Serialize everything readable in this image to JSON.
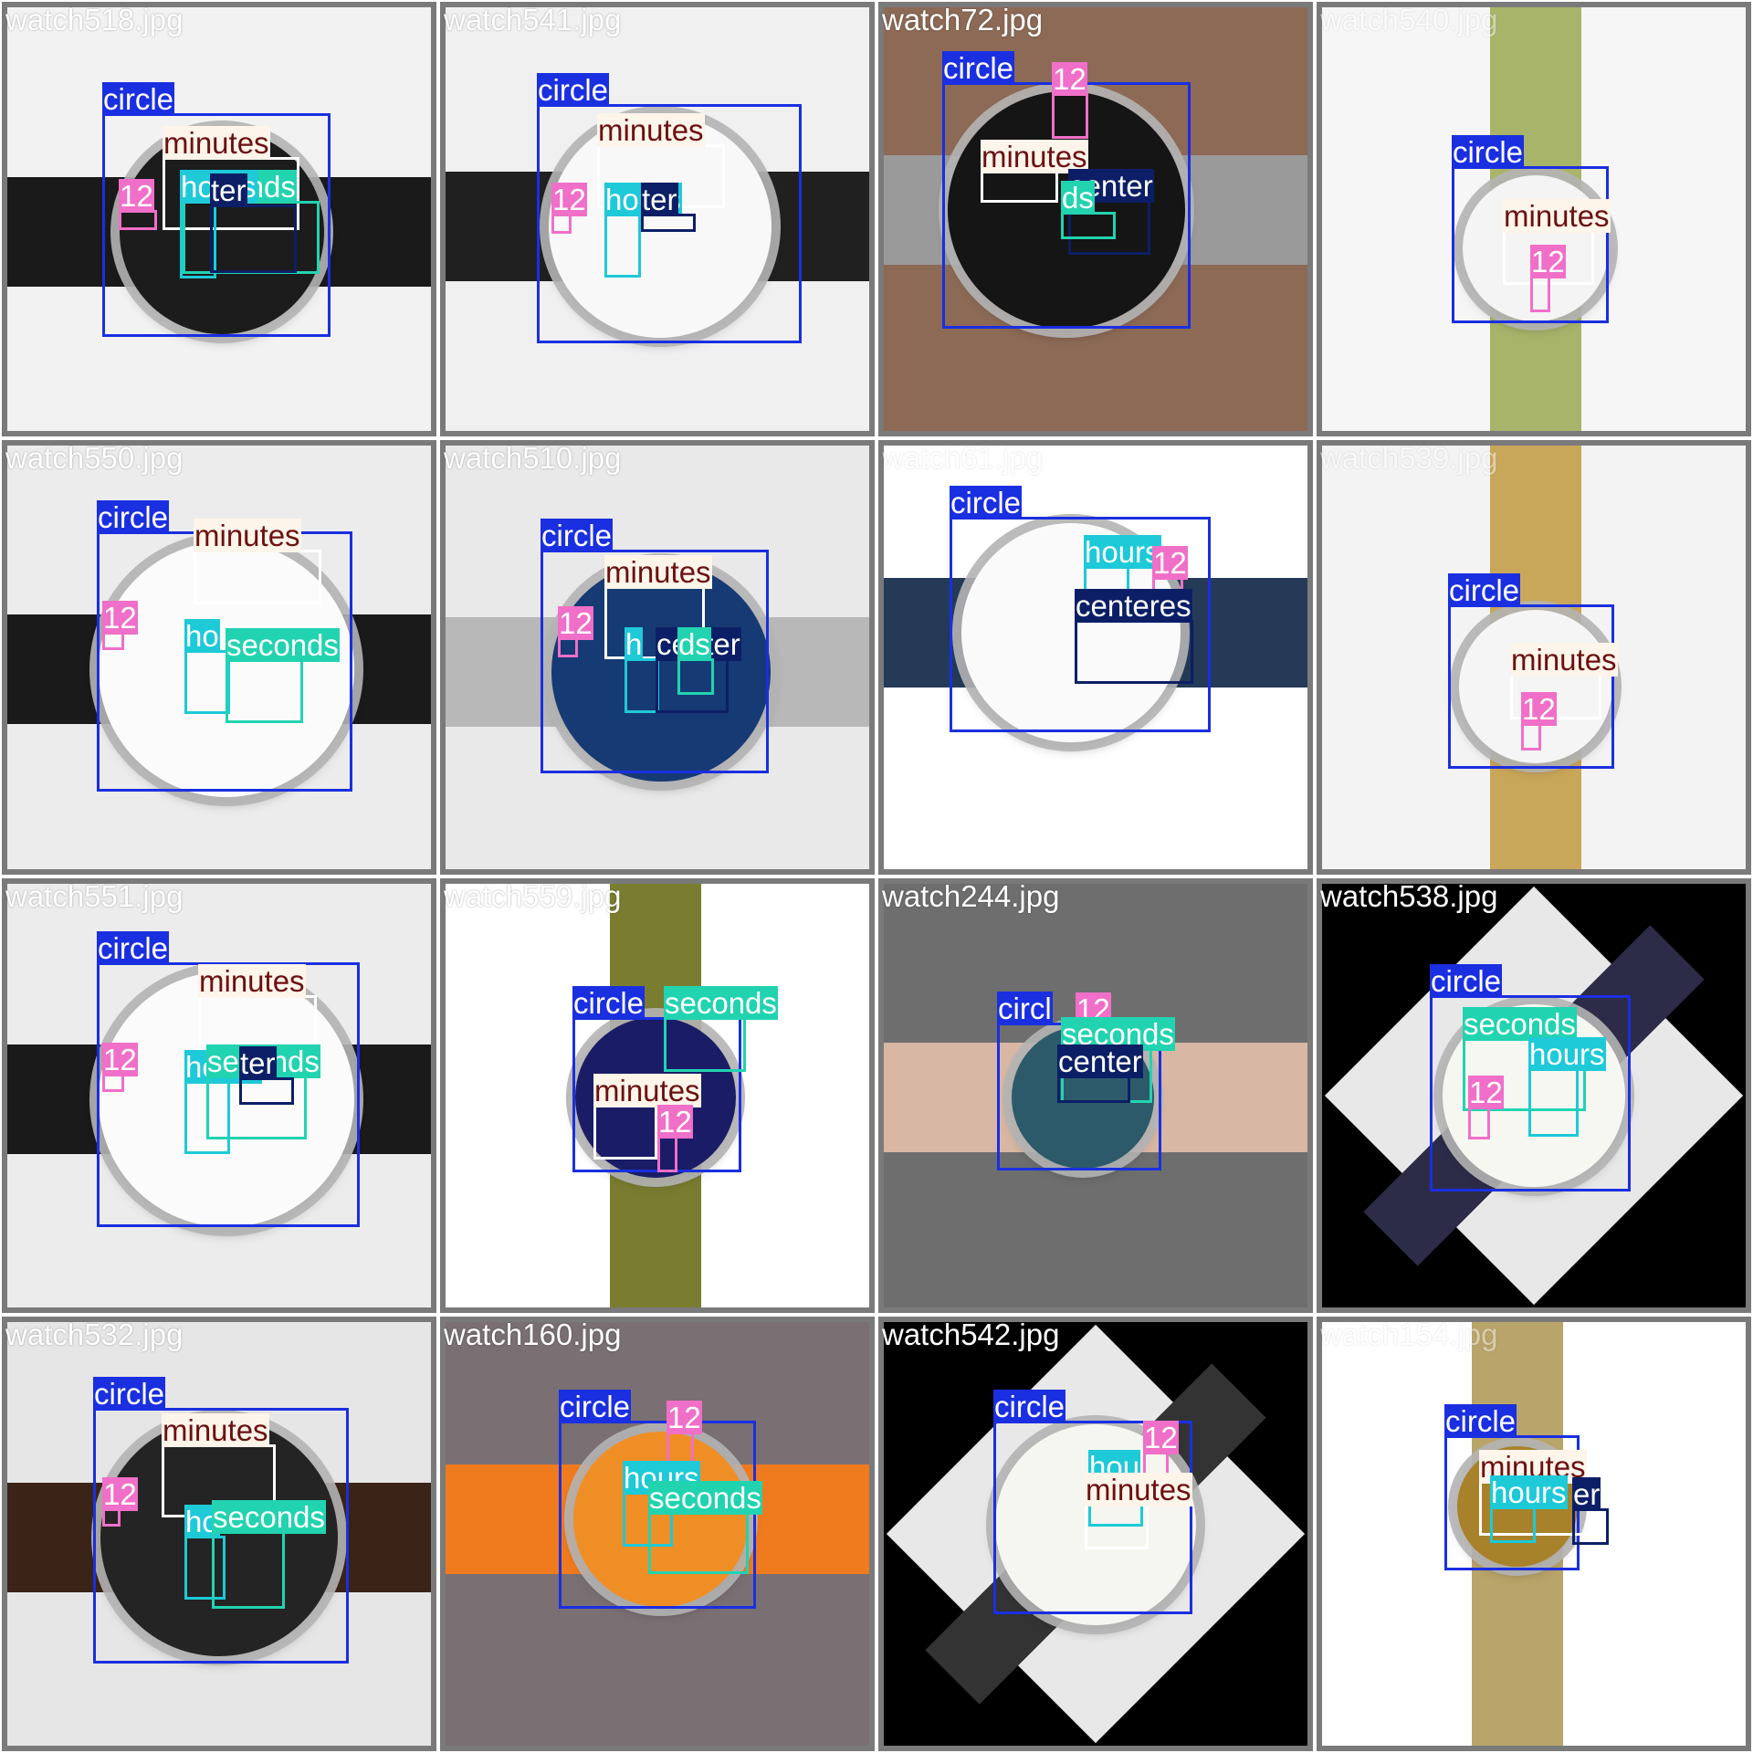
{
  "colors": {
    "circle": "#1a2fe0",
    "minutes": "#fdf4ea",
    "minutes_text": "#6b1010",
    "seconds": "#22d3b0",
    "hours": "#1ec9d8",
    "center": "#0c1f66",
    "twelve": "#f06fc8",
    "tile_bg": "#7a7a7a"
  },
  "tiles": [
    {
      "file": "watch518.jpg",
      "labels": [
        "circle",
        "minutes",
        "seconds",
        "hours",
        "ter",
        "12"
      ]
    },
    {
      "file": "watch541.jpg",
      "labels": [
        "circle",
        "minutes",
        "hours",
        "ter",
        "12"
      ]
    },
    {
      "file": "watch72.jpg",
      "labels": [
        "circle",
        "12",
        "minutes",
        "center",
        "ds"
      ]
    },
    {
      "file": "watch540.jpg",
      "labels": [
        "circle",
        "minutes",
        "12"
      ]
    },
    {
      "file": "watch550.jpg",
      "labels": [
        "circle",
        "minutes",
        "12",
        "ho",
        "seconds"
      ]
    },
    {
      "file": "watch510.jpg",
      "labels": [
        "circle",
        "minutes",
        "12",
        "h",
        "center",
        "ds"
      ]
    },
    {
      "file": "watch61.jpg",
      "labels": [
        "circle",
        "hours",
        "12",
        "centeres"
      ]
    },
    {
      "file": "watch539.jpg",
      "labels": [
        "circle",
        "minutes",
        "12"
      ]
    },
    {
      "file": "watch551.jpg",
      "labels": [
        "circle",
        "minutes",
        "12",
        "hours",
        "seconds",
        "ter"
      ]
    },
    {
      "file": "watch559.jpg",
      "labels": [
        "circle",
        "seconds",
        "minutes",
        "12"
      ]
    },
    {
      "file": "watch244.jpg",
      "labels": [
        "circl",
        "12",
        "seconds",
        "center"
      ]
    },
    {
      "file": "watch538.jpg",
      "labels": [
        "circle",
        "seconds",
        "hours",
        "12"
      ]
    },
    {
      "file": "watch532.jpg",
      "labels": [
        "circle",
        "minutes",
        "12",
        "ho",
        "seconds"
      ]
    },
    {
      "file": "watch160.jpg",
      "labels": [
        "circle",
        "12",
        "hours",
        "seconds"
      ]
    },
    {
      "file": "watch542.jpg",
      "labels": [
        "circle",
        "12",
        "hou",
        "minutes"
      ]
    },
    {
      "file": "watch154.jpg",
      "labels": [
        "circle",
        "minutes",
        "hours",
        "er"
      ]
    }
  ]
}
